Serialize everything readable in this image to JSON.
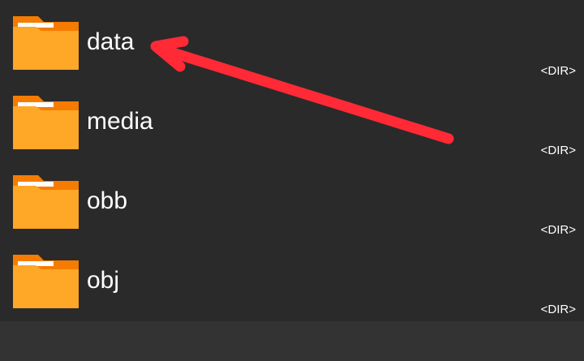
{
  "file_list": {
    "items": [
      {
        "name": "data",
        "type_label": "<DIR>",
        "icon": "folder-icon"
      },
      {
        "name": "media",
        "type_label": "<DIR>",
        "icon": "folder-icon"
      },
      {
        "name": "obb",
        "type_label": "<DIR>",
        "icon": "folder-icon"
      },
      {
        "name": "obj",
        "type_label": "<DIR>",
        "icon": "folder-icon"
      }
    ]
  },
  "annotation": {
    "arrow_icon": "arrow-icon",
    "arrow_color": "#ff2a35",
    "points_to": "data"
  },
  "colors": {
    "background": "#2a2a2a",
    "bottom_bar": "#333333",
    "folder_body": "#ffa726",
    "folder_tab": "#f57c00",
    "text": "#ffffff"
  }
}
